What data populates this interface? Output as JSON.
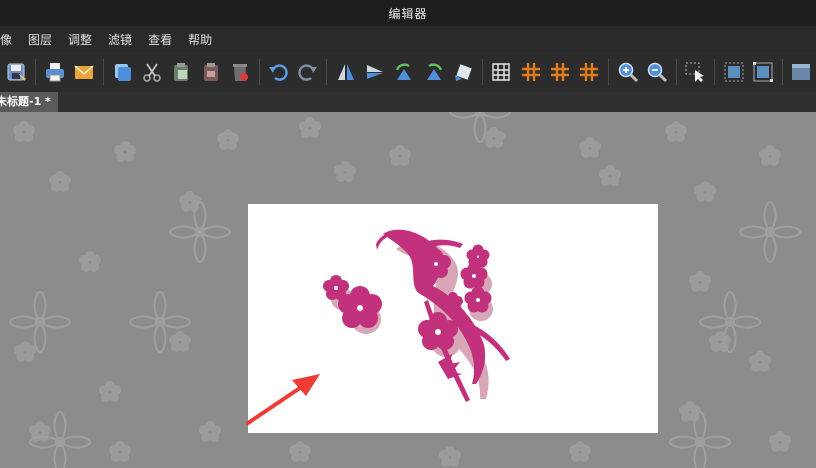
{
  "window": {
    "title": "编辑器"
  },
  "menu": {
    "items": [
      "像",
      "图层",
      "调整",
      "滤镜",
      "查看",
      "帮助"
    ]
  },
  "toolbar": {
    "groups": [
      [
        "save-as-icon"
      ],
      [
        "print-icon",
        "email-icon"
      ],
      [
        "copy-icon",
        "cut-icon",
        "paste-icon",
        "paste-new-icon",
        "delete-icon"
      ],
      [
        "undo-icon",
        "redo-icon"
      ],
      [
        "flip-horizontal-icon",
        "flip-vertical-icon",
        "rotate-left-icon",
        "rotate-right-icon",
        "rotate-free-icon"
      ],
      [
        "grid-icon",
        "hash-icon",
        "hash-icon",
        "hash-icon"
      ],
      [
        "zoom-in-icon",
        "zoom-out-icon"
      ],
      [
        "select-icon"
      ],
      [
        "crop-icon",
        "resize-icon"
      ],
      [
        "panel-icon"
      ]
    ],
    "accent": "#e07b1f"
  },
  "tabs": [
    {
      "label": "未标题-1 *"
    }
  ],
  "colors": {
    "canvas_bg": "#8c8c8c",
    "flower": "#c2317c",
    "flower_shadow": "#d7a7b7",
    "arrow": "#ee3b34"
  }
}
